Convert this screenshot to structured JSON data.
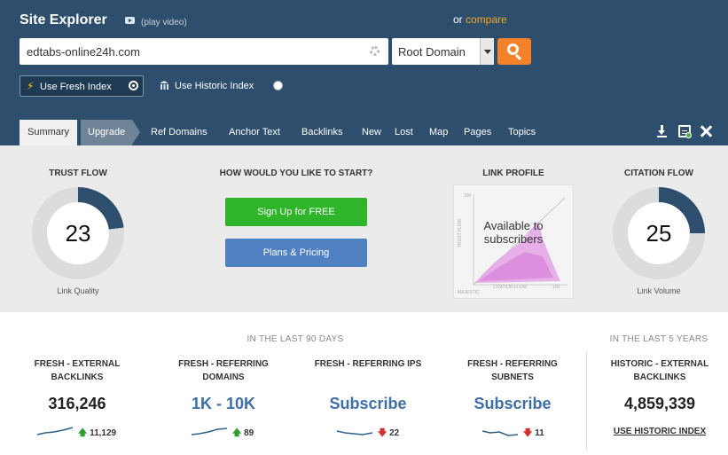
{
  "header": {
    "title": "Site Explorer",
    "play_video": "(play video)",
    "or_text": "or",
    "compare": "compare"
  },
  "search": {
    "value": "edtabs-online24h.com",
    "placeholder": "",
    "scope": "Root Domain"
  },
  "index": {
    "fresh_label": "Use Fresh Index",
    "fresh_selected": true,
    "historic_label": "Use Historic Index"
  },
  "tabs": [
    {
      "label": "Summary",
      "active": true
    },
    {
      "label": "Upgrade"
    },
    {
      "label": "Ref Domains"
    },
    {
      "label": "Anchor Text"
    },
    {
      "label": "Backlinks"
    },
    {
      "label": "New"
    },
    {
      "label": "Lost"
    },
    {
      "label": "Map"
    },
    {
      "label": "Pages"
    },
    {
      "label": "Topics"
    }
  ],
  "summary": {
    "trust_flow": {
      "title": "TRUST FLOW",
      "value": "23",
      "caption": "Link Quality",
      "accent": "#2d4e6c"
    },
    "start": {
      "title": "HOW WOULD YOU LIKE TO START?",
      "signup": "Sign Up for FREE",
      "plans": "Plans & Pricing"
    },
    "link_profile": {
      "title": "LINK PROFILE",
      "overlay": "Available to subscribers",
      "y_axis": "TRUST FLOW",
      "x_axis": "CITATION FLOW",
      "tick_100_y": "100",
      "tick_100_x": "100",
      "brand": "MAJESTIC"
    },
    "citation_flow": {
      "title": "CITATION FLOW",
      "value": "25",
      "caption": "Link Volume",
      "accent": "#2d4e6c"
    }
  },
  "stats": {
    "period_recent": "IN THE LAST 90 DAYS",
    "period_historic": "IN THE LAST 5 YEARS",
    "items": [
      {
        "label": "FRESH - EXTERNAL BACKLINKS",
        "value": "316,246",
        "trend": "up",
        "delta": "11,129"
      },
      {
        "label": "FRESH - REFERRING DOMAINS",
        "value": "1K - 10K",
        "trend": "up",
        "delta": "89"
      },
      {
        "label": "FRESH - REFERRING IPS",
        "value": "Subscribe",
        "trend": "down",
        "delta": "22"
      },
      {
        "label": "FRESH - REFERRING SUBNETS",
        "value": "Subscribe",
        "trend": "down",
        "delta": "11"
      },
      {
        "label": "HISTORIC - EXTERNAL BACKLINKS",
        "value": "4,859,339"
      }
    ],
    "use_historic": "USE HISTORIC INDEX"
  }
}
